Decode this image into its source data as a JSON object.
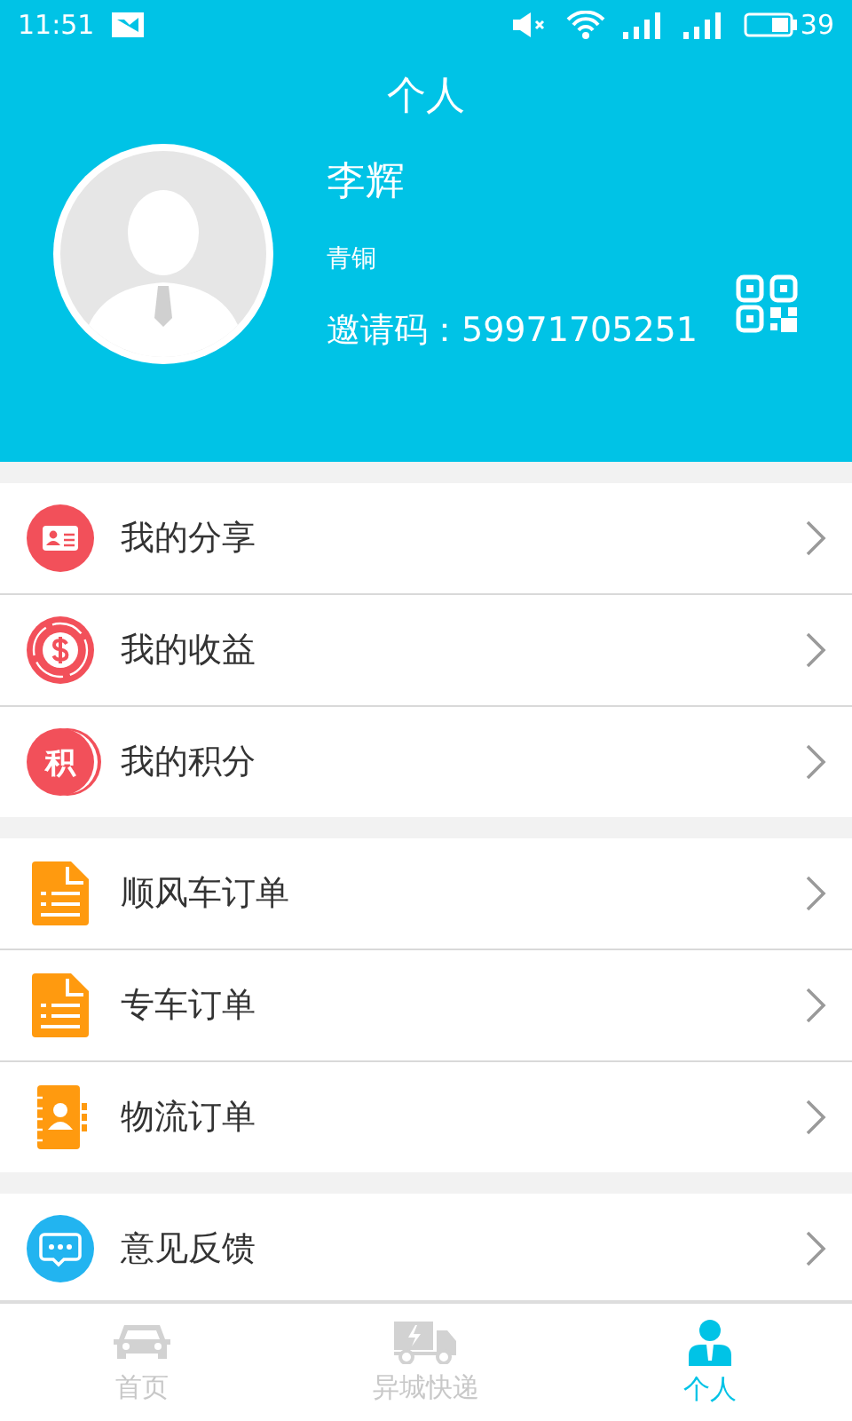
{
  "status_bar": {
    "time": "11:51",
    "battery": "39"
  },
  "header": {
    "title": "个人"
  },
  "profile": {
    "name": "李辉",
    "level": "青铜",
    "invite_code": "邀请码：59971705251"
  },
  "menu_groups": [
    {
      "items": [
        {
          "kind": "share",
          "label": "我的分享"
        },
        {
          "kind": "money",
          "label": "我的收益"
        },
        {
          "kind": "points",
          "label": "我的积分",
          "icon_text": "积"
        }
      ]
    },
    {
      "items": [
        {
          "kind": "document",
          "label": "顺风车订单"
        },
        {
          "kind": "document",
          "label": "专车订单"
        },
        {
          "kind": "contacts",
          "label": "物流订单"
        }
      ]
    },
    {
      "items": [
        {
          "kind": "chat",
          "label": "意见反馈"
        }
      ]
    }
  ],
  "tabs": [
    {
      "kind": "car",
      "label": "首页",
      "selected": false
    },
    {
      "kind": "truck",
      "label": "异城快递",
      "selected": false
    },
    {
      "kind": "person",
      "label": "个人",
      "selected": true
    }
  ]
}
